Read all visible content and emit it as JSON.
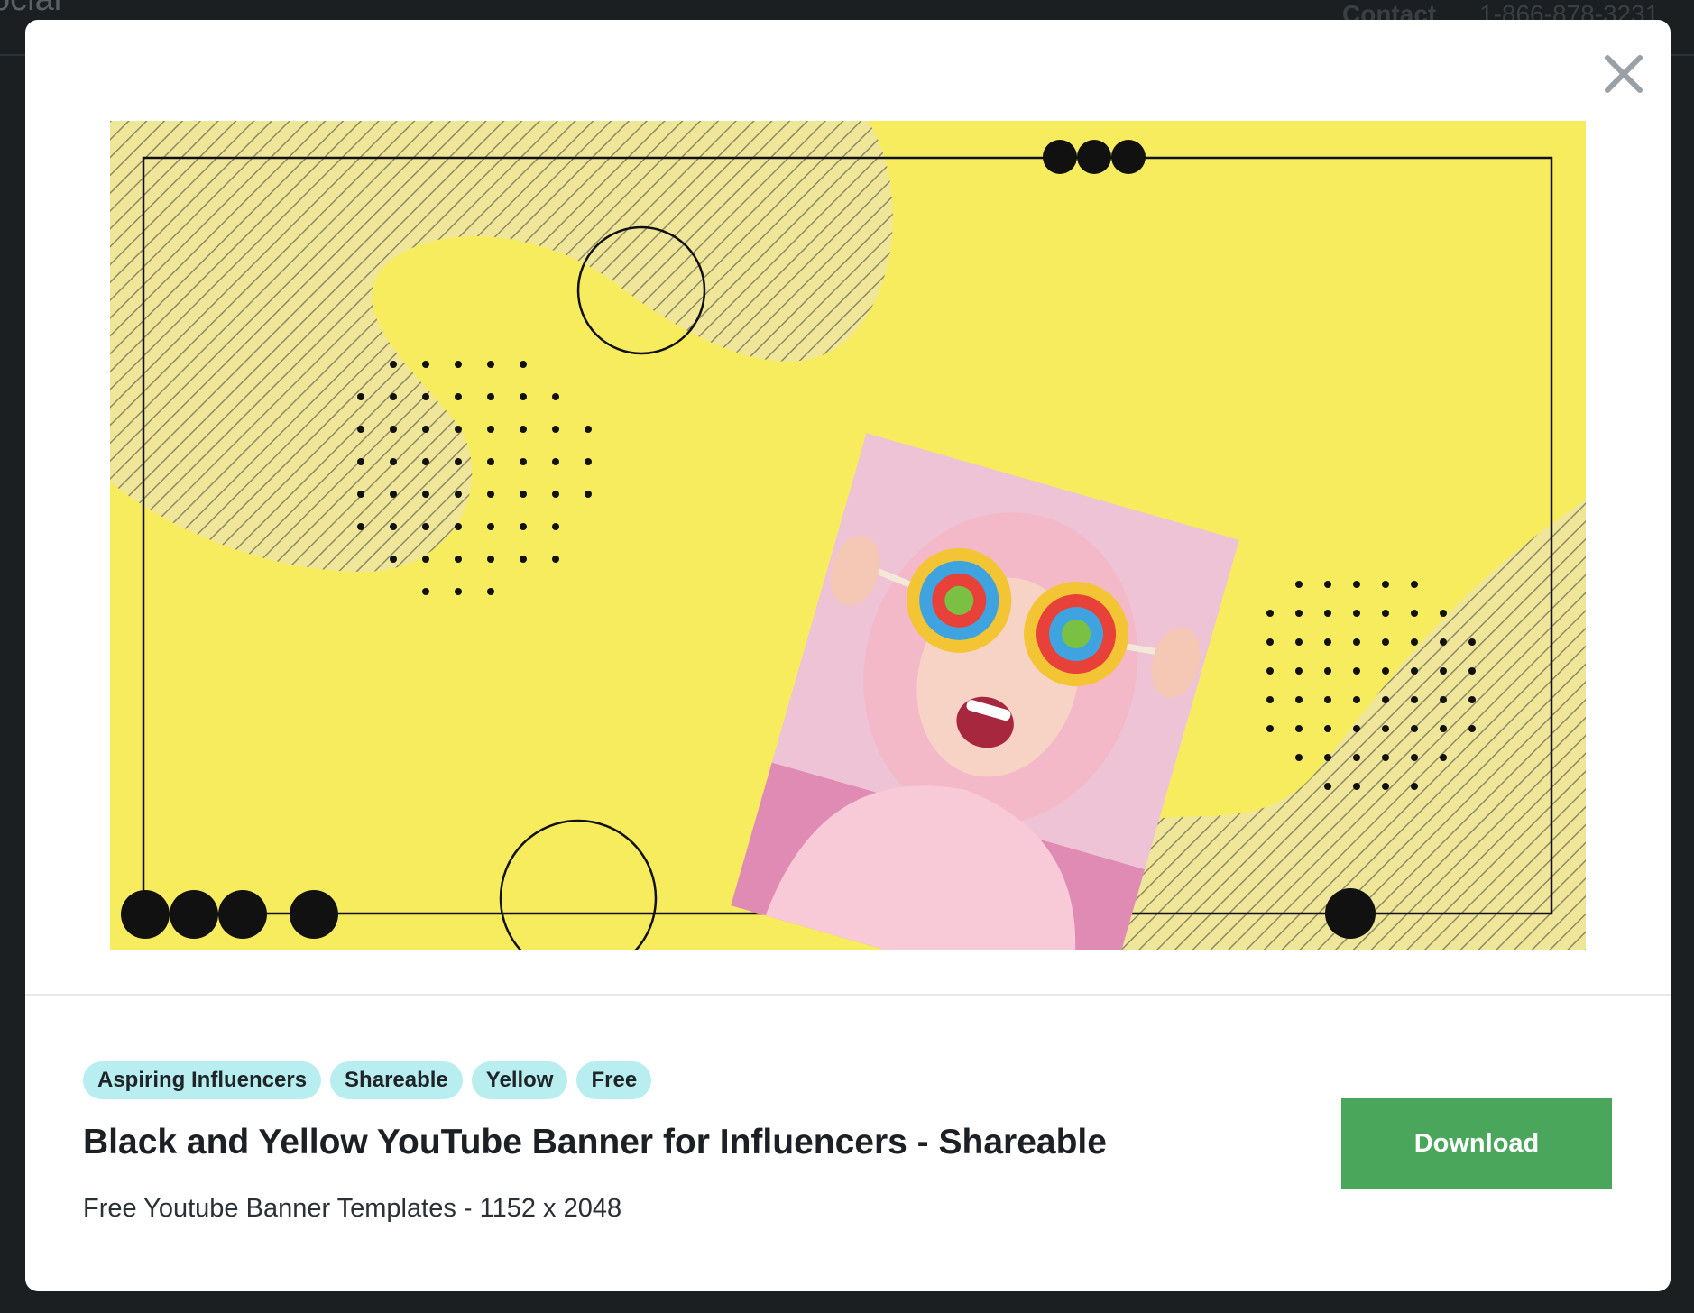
{
  "background_page": {
    "logo_fragment": "ocial",
    "contact_label": "Contact",
    "phone": "1-866-878-3231"
  },
  "modal": {
    "close_icon": "close-icon",
    "preview": {
      "description_icon": "banner-preview",
      "colors": {
        "background": "#f7ec5e",
        "accent": "#111111"
      }
    },
    "tags": [
      "Aspiring Influencers",
      "Shareable",
      "Yellow",
      "Free"
    ],
    "title": "Black and Yellow YouTube Banner for Influencers - Shareable",
    "subtitle": "Free Youtube Banner Templates - 1152 x 2048",
    "download_label": "Download",
    "colors": {
      "tag_bg": "#b8eef0",
      "download_bg": "#4aa65a"
    }
  }
}
